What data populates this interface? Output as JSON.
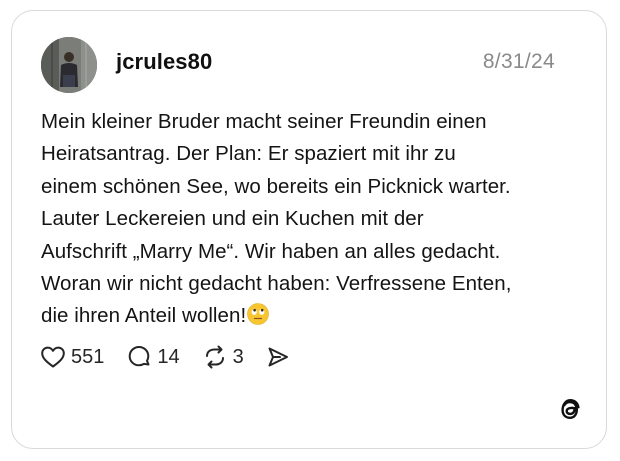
{
  "post": {
    "username": "jcrules80",
    "date": "8/31/24",
    "text": "Mein kleiner Bruder macht seiner Freundin einen\nHeiratsantrag. Der Plan: Er spaziert mit ihr zu\neinem schönen See, wo bereits ein Picknick warter.\nLauter Leckereien und ein Kuchen mit der\nAufschrift „Marry Me“. Wir haben an alles gedacht.\nWoran wir nicht gedacht haben: Verfressene Enten,\ndie ihren Anteil wollen!",
    "emoji": "eye-roll-emoji"
  },
  "actions": {
    "likes": "551",
    "comments": "14",
    "reposts": "3"
  },
  "icons": {
    "like": "heart-icon",
    "comment": "comment-bubble-icon",
    "repost": "repost-icon",
    "share": "send-icon",
    "brand": "threads-logo-icon"
  }
}
